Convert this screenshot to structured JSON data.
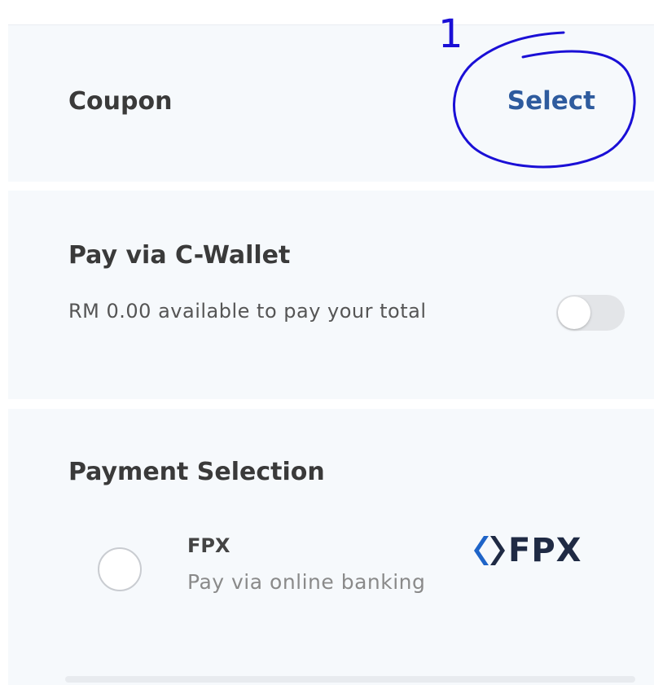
{
  "annotation": {
    "number": "1",
    "color": "#1a0fd6"
  },
  "coupon": {
    "title": "Coupon",
    "action_label": "Select"
  },
  "wallet": {
    "title": "Pay via C-Wallet",
    "description": "RM 0.00 available to pay your total",
    "toggle_on": false
  },
  "payment": {
    "title": "Payment Selection",
    "options": [
      {
        "name": "FPX",
        "description": "Pay via online banking",
        "logo_text": "FPX",
        "selected": false
      }
    ]
  },
  "colors": {
    "accent": "#2e5b9e",
    "card_background": "#f6f9fc",
    "fpx_blue": "#1e64c8",
    "fpx_navy": "#1f2a44"
  }
}
